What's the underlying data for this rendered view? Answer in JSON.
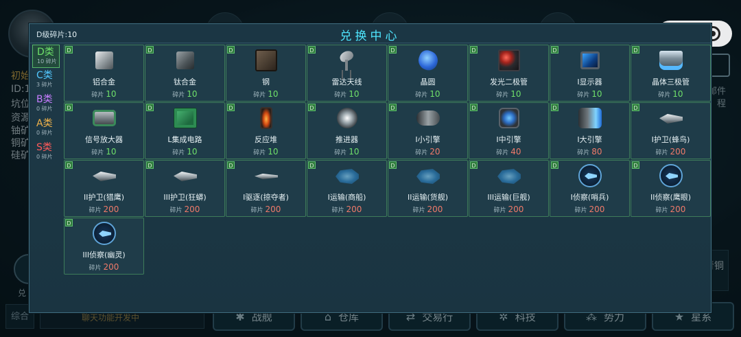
{
  "background": {
    "left_texts": [
      "初始",
      "ID:1(",
      "坑位",
      "资源",
      "铀矿",
      "铜矿",
      "硅矿"
    ],
    "right_texts": [
      "邮件",
      "程"
    ],
    "exchange_short": "兑",
    "rank_text": "青铜",
    "chat_tab": "综合",
    "notice": "聊天功能开发中",
    "nav": [
      {
        "label": "战舰",
        "icon": "✱"
      },
      {
        "label": "仓库",
        "icon": "⌂"
      },
      {
        "label": "交易行",
        "icon": "⇄"
      },
      {
        "label": "科技",
        "icon": "✲"
      },
      {
        "label": "势力",
        "icon": "⁂"
      },
      {
        "label": "星系",
        "icon": "★"
      }
    ]
  },
  "capsule": {
    "more": "•••",
    "close": "close"
  },
  "panel": {
    "title": "兑换中心",
    "fragment_label": "D级碎片:",
    "fragment_value": "10"
  },
  "categories": [
    {
      "name": "D类",
      "count": "10 碎片",
      "color": "#6fe06a",
      "active": true
    },
    {
      "name": "C类",
      "count": "3 碎片",
      "color": "#52c8ff",
      "active": false
    },
    {
      "name": "B类",
      "count": "0 碎片",
      "color": "#c77dff",
      "active": false
    },
    {
      "name": "A类",
      "count": "0 碎片",
      "color": "#f0b24a",
      "active": false
    },
    {
      "name": "S类",
      "count": "0 碎片",
      "color": "#ff5a5a",
      "active": false
    }
  ],
  "price_label": "碎片",
  "items": [
    {
      "grade": "D",
      "name": "铝合金",
      "price": 10,
      "affordable": true,
      "icon": "cube"
    },
    {
      "grade": "D",
      "name": "钛合金",
      "price": 10,
      "affordable": true,
      "icon": "cube-dark"
    },
    {
      "grade": "D",
      "name": "钢",
      "price": 10,
      "affordable": true,
      "icon": "box"
    },
    {
      "grade": "D",
      "name": "雷达天线",
      "price": 10,
      "affordable": true,
      "icon": "dish"
    },
    {
      "grade": "D",
      "name": "晶圆",
      "price": 10,
      "affordable": true,
      "icon": "crystal"
    },
    {
      "grade": "D",
      "name": "发光二极管",
      "price": 10,
      "affordable": true,
      "icon": "diode"
    },
    {
      "grade": "D",
      "name": "I显示器",
      "price": 10,
      "affordable": true,
      "icon": "screen"
    },
    {
      "grade": "D",
      "name": "晶体三极管",
      "price": 10,
      "affordable": true,
      "icon": "triode"
    },
    {
      "grade": "D",
      "name": "信号放大器",
      "price": 10,
      "affordable": true,
      "icon": "amp"
    },
    {
      "grade": "D",
      "name": "L集成电路",
      "price": 10,
      "affordable": true,
      "icon": "chip"
    },
    {
      "grade": "D",
      "name": "反应堆",
      "price": 10,
      "affordable": true,
      "icon": "reactor"
    },
    {
      "grade": "D",
      "name": "推进器",
      "price": 10,
      "affordable": true,
      "icon": "thruster"
    },
    {
      "grade": "D",
      "name": "I小引擎",
      "price": 20,
      "affordable": false,
      "icon": "engine"
    },
    {
      "grade": "D",
      "name": "I中引擎",
      "price": 40,
      "affordable": false,
      "icon": "engine2"
    },
    {
      "grade": "D",
      "name": "I大引擎",
      "price": 80,
      "affordable": false,
      "icon": "engine3"
    },
    {
      "grade": "D",
      "name": "I护卫(蜂鸟)",
      "price": 200,
      "affordable": false,
      "icon": "ship"
    },
    {
      "grade": "D",
      "name": "II护卫(猎鹰)",
      "price": 200,
      "affordable": false,
      "icon": "ship"
    },
    {
      "grade": "D",
      "name": "III护卫(狂蟒)",
      "price": 200,
      "affordable": false,
      "icon": "ship"
    },
    {
      "grade": "D",
      "name": "I驱逐(掠夺者)",
      "price": 200,
      "affordable": false,
      "icon": "ship-thin"
    },
    {
      "grade": "D",
      "name": "I运输(商船)",
      "price": 200,
      "affordable": false,
      "icon": "ghostship"
    },
    {
      "grade": "D",
      "name": "II运输(货舰)",
      "price": 200,
      "affordable": false,
      "icon": "ghostship"
    },
    {
      "grade": "D",
      "name": "III运输(巨舰)",
      "price": 200,
      "affordable": false,
      "icon": "ghostship"
    },
    {
      "grade": "D",
      "name": "I侦察(哨兵)",
      "price": 200,
      "affordable": false,
      "icon": "scout"
    },
    {
      "grade": "D",
      "name": "II侦察(鹰眼)",
      "price": 200,
      "affordable": false,
      "icon": "scout"
    },
    {
      "grade": "D",
      "name": "III侦察(幽灵)",
      "price": 200,
      "affordable": false,
      "icon": "scout"
    }
  ]
}
